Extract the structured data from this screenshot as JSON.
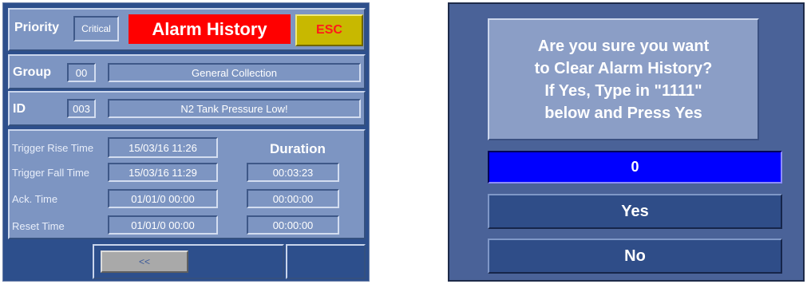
{
  "alarm_panel": {
    "priority_label": "Priority",
    "priority_value": "Critical",
    "title": "Alarm History",
    "esc_label": "ESC",
    "group_label": "Group",
    "group_number": "00",
    "group_name": "General Collection",
    "id_label": "ID",
    "id_number": "003",
    "id_description": "N2 Tank Pressure Low!",
    "duration_header": "Duration",
    "rows": [
      {
        "label": "Trigger Rise Time",
        "time": "15/03/16  11:26",
        "duration": ""
      },
      {
        "label": "Trigger Fall Time",
        "time": "15/03/16  11:29",
        "duration": "00:03:23"
      },
      {
        "label": "Ack. Time",
        "time": "01/01/0  00:00",
        "duration": "00:00:00"
      },
      {
        "label": "Reset Time",
        "time": "01/01/0  00:00",
        "duration": "00:00:00"
      }
    ],
    "back_label": "<<"
  },
  "confirm_dialog": {
    "message_lines": [
      "Are you sure you want",
      "to Clear Alarm History?",
      "If Yes, Type in \"1111\"",
      "below and Press Yes"
    ],
    "entry_value": "0",
    "yes_label": "Yes",
    "no_label": "No"
  },
  "colors": {
    "panel_bg": "#2d4f8c",
    "field_bg": "#7d95c2",
    "title_red": "#ff0000",
    "esc_yellow": "#c8b800",
    "entry_blue": "#0000ff"
  }
}
